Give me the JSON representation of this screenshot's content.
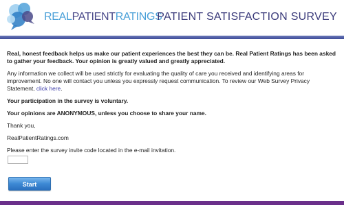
{
  "header": {
    "brand": {
      "part1": "REAL",
      "part2": "PATIENT",
      "part3": "RATINGS"
    },
    "survey_title": "PATIENT SATISFACTION SURVEY",
    "logo_icon": "speech-bubbles-logo-icon"
  },
  "content": {
    "intro": "Real, honest feedback helps us make our patient experiences the best they can be. Real Patient Ratings has been asked to gather your feedback. Your opinion is greatly valued and greatly appreciated.",
    "privacy_text": "Any information we collect will be used strictly for evaluating the quality of care you received and identifying areas for improvement. No one will contact you unless you expressly request communication. To review our Web Survey Privacy Statement, ",
    "privacy_link": "click here",
    "privacy_end": ".",
    "voluntary": "Your participation in the survey is voluntary.",
    "anonymous": "Your opinions are ANONYMOUS, unless you choose to share your name.",
    "thanks": "Thank you,",
    "signature": "RealPatientRatings.com",
    "invite_prompt": "Please enter the survey invite code located in the e-mail invitation."
  },
  "form": {
    "invite_code_value": "",
    "start_label": "Start"
  },
  "colors": {
    "brand_blue": "#4aa0d8",
    "brand_navy": "#4a4a8a",
    "header_bar": "#3e4c98",
    "footer_bar": "#6a2f8a",
    "button_blue": "#3d89d4",
    "link": "#3a3aa8"
  }
}
